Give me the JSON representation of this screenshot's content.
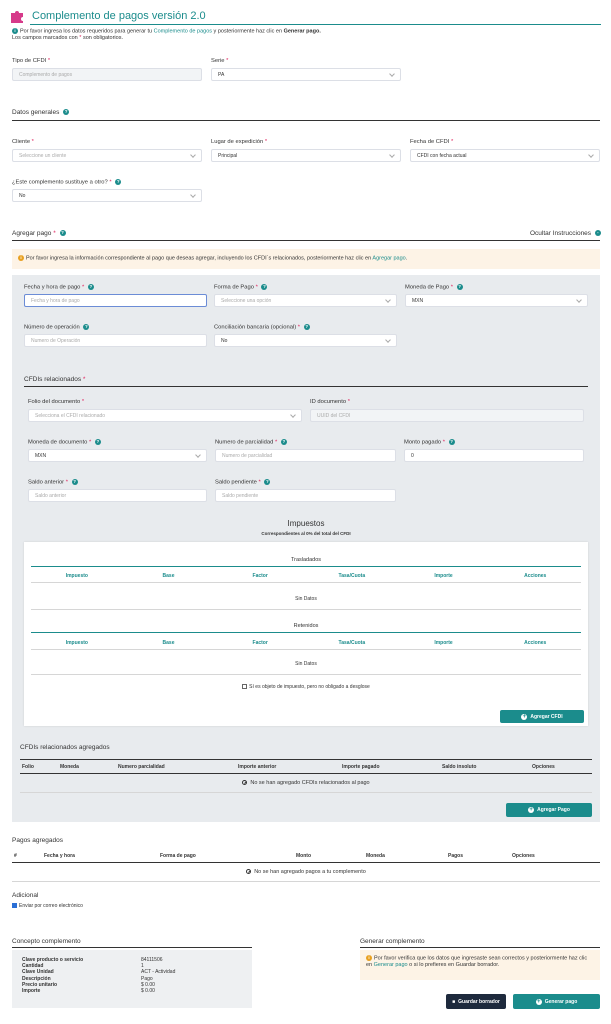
{
  "header": {
    "title": "Complemento de pagos versión 2.0",
    "intro_prefix": "Por favor ingresa los datos requeridos para generar tu",
    "intro_link": "Complemento de pagos",
    "intro_mid": "y posteriormente haz clic en",
    "intro_bold": "Generar pago.",
    "intro_line2_a": "Los campos marcados con",
    "intro_line2_b": "son obligatorios.",
    "required_mark": "*"
  },
  "top": {
    "tipo_label": "Tipo de CFDI",
    "tipo_value": "Complemento de pagos",
    "serie_label": "Serie",
    "serie_value": "PA"
  },
  "datos": {
    "title": "Datos generales",
    "cliente_label": "Cliente",
    "cliente_placeholder": "Seleccione un cliente",
    "lugar_label": "Lugar de expedición",
    "lugar_value": "Principal",
    "fecha_label": "Fecha de CFDI",
    "fecha_value": "CFDI con fecha actual",
    "sustituye_label": "¿Este complemento sustituye a otro?",
    "sustituye_value": "No"
  },
  "agregar": {
    "title": "Agregar pago",
    "ocultar": "Ocultar Instrucciones",
    "notice_prefix": "Por favor ingresa la información correspondiente al pago que deseas agregar, incluyendo los CFDI´s relacionados, posteriormente haz clic en",
    "notice_link": "Agregar pago",
    "notice_suffix": ".",
    "fecha_hora_label": "Fecha y hora de pago",
    "fecha_hora_placeholder": "Fecha y hora de pago",
    "forma_label": "Forma de Pago",
    "forma_placeholder": "Seleccione una opción",
    "moneda_label": "Moneda de Pago",
    "moneda_value": "MXN",
    "num_op_label": "Número de operación",
    "num_op_placeholder": "Numero de Operación",
    "conciliacion_label": "Conciliación bancaria (opcional)",
    "conciliacion_value": "No"
  },
  "cfdis": {
    "title": "CFDIs relacionados",
    "folio_label": "Folio del documento",
    "folio_placeholder": "Selecciona el CFDI relacionado",
    "id_label": "ID documento",
    "id_placeholder": "UUID del CFDI",
    "moneda_doc_label": "Moneda de documento",
    "moneda_doc_value": "MXN",
    "parcialidad_label": "Numero de parcialidad",
    "parcialidad_placeholder": "Numero de parcialidad",
    "monto_label": "Monto pagado",
    "monto_value": "0",
    "saldo_ant_label": "Saldo anterior",
    "saldo_ant_placeholder": "Saldo anterior",
    "saldo_pend_label": "Saldo pendiente",
    "saldo_pend_placeholder": "Saldo pendiente"
  },
  "impuestos": {
    "title": "Impuestos",
    "subtitle": "Correspondientes al 0% del total del CFDI",
    "trasladados": "Trasladados",
    "retenidos": "Retenidos",
    "columns": [
      "Impuesto",
      "Base",
      "Factor",
      "Tasa/Cuota",
      "Importe",
      "Acciones"
    ],
    "sin_datos": "Sin Datos",
    "checkbox_label": "Sí es objeto de impuesto, pero no obligado a desglose",
    "agregar_cfdi_btn": "Agregar CFDI"
  },
  "cfdis_agregados": {
    "title": "CFDIs relacionados agregados",
    "columns": [
      "Folio",
      "Moneda",
      "Numero parcialidad",
      "Importe anterior",
      "Importe pagado",
      "Saldo insoluto",
      "Opciones"
    ],
    "empty": "No se han agregado CFDIs relacionados al pago",
    "agregar_pago_btn": "Agregar Pago"
  },
  "pagos": {
    "title": "Pagos agregados",
    "columns": [
      "#",
      "Fecha y hora",
      "Forma de pago",
      "Monto",
      "Moneda",
      "Pagos",
      "Opciones"
    ],
    "empty": "No se han agregado pagos a tu complemento"
  },
  "adicional": {
    "title": "Adicional",
    "email_label": "Enviar por correo electrónico"
  },
  "concepto": {
    "title": "Concepto complemento",
    "rows": [
      {
        "k": "Clave producto o servicio",
        "v": "84111506"
      },
      {
        "k": "Cantidad",
        "v": "1"
      },
      {
        "k": "Clave Unidad",
        "v": "ACT - Actividad"
      },
      {
        "k": "Descripción",
        "v": "Pago"
      },
      {
        "k": "Precio unitario",
        "v": "$ 0.00"
      },
      {
        "k": "Importe",
        "v": "$ 0.00"
      }
    ]
  },
  "generar": {
    "title": "Generar complemento",
    "notice_prefix": "Por favor verifica que los datos que ingresaste sean correctos y posteriormente haz clic en",
    "notice_link": "Generar pago",
    "notice_suffix": "o si lo prefieres en Guardar borrador.",
    "guardar_btn": "Guardar borrador",
    "generar_btn": "Generar pago"
  },
  "colors": {
    "accent": "#1b8c8c",
    "required": "#e0245e",
    "dark_button": "#1e2a3d",
    "warning_bg": "#fdf3e6"
  }
}
